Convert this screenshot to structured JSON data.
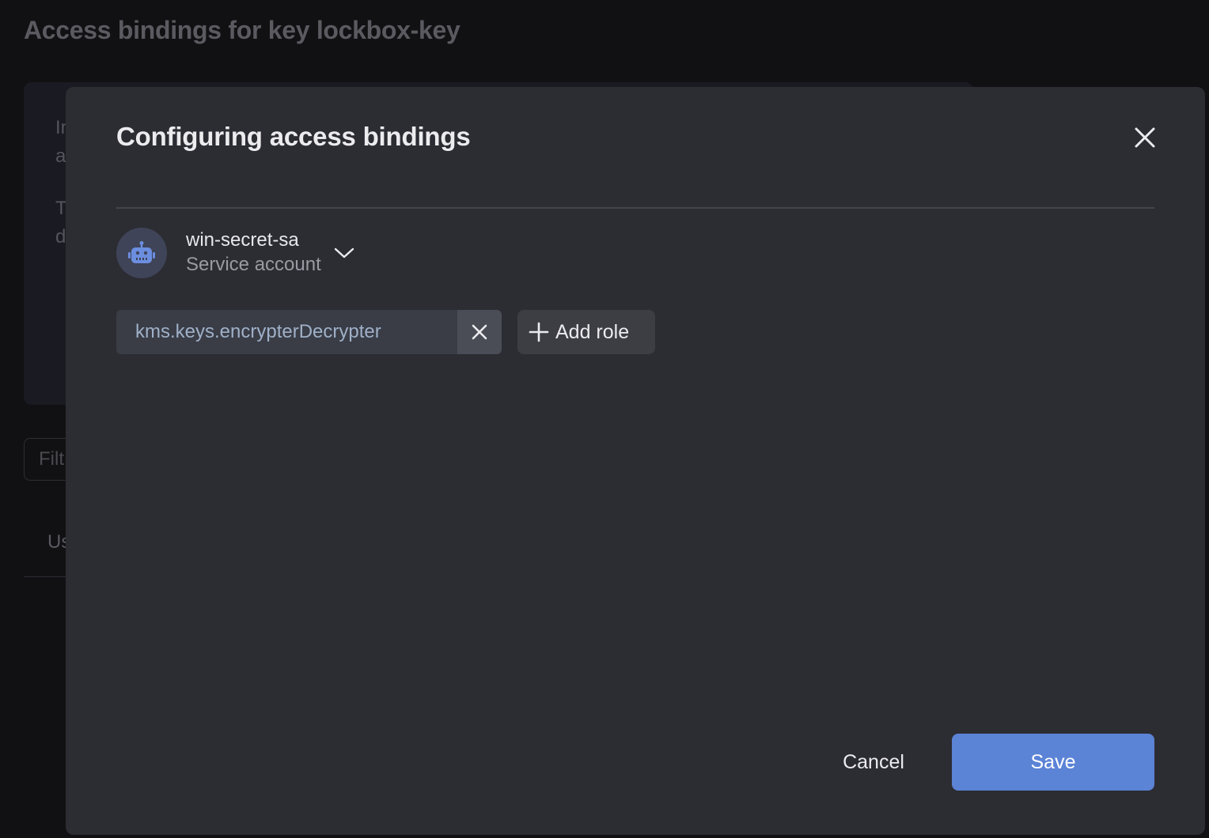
{
  "page": {
    "title": "Access bindings for key lockbox-key",
    "bg_text_lines": [
      "In",
      "a",
      "T",
      "d"
    ],
    "filter_placeholder": "Filt",
    "tab_label": "Us"
  },
  "modal": {
    "title": "Configuring access bindings",
    "subject": {
      "name": "win-secret-sa",
      "type": "Service account",
      "icon": "robot-icon"
    },
    "roles": [
      {
        "name": "kms.keys.encrypterDecrypter"
      }
    ],
    "add_role_label": "Add role",
    "cancel_label": "Cancel",
    "save_label": "Save"
  },
  "colors": {
    "accent": "#5b83d6",
    "modal_bg": "#2c2c33",
    "page_bg": "#111114"
  }
}
